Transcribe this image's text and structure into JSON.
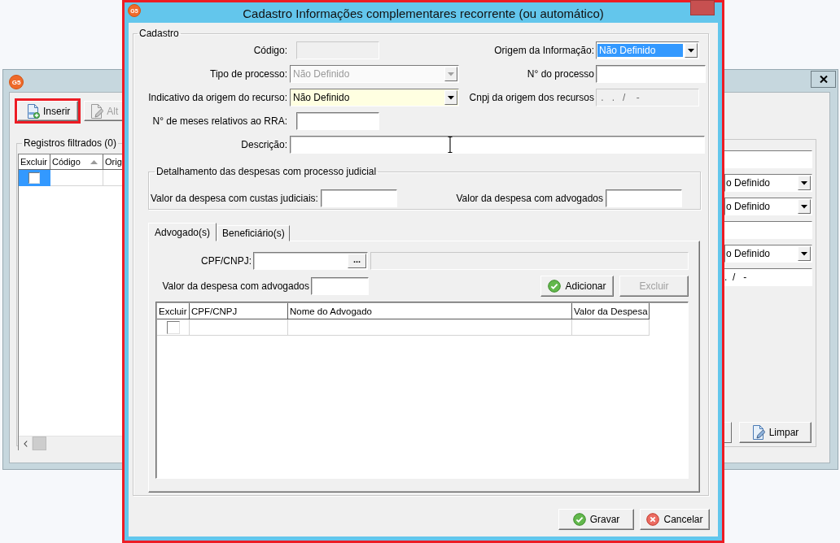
{
  "background_window": {
    "logo": "G5",
    "toolbar": [
      {
        "kind": "insert",
        "label": "Inserir",
        "disabled": false,
        "highlighted": true
      },
      {
        "kind": "edit",
        "label": "Alt",
        "disabled": true,
        "highlighted": false
      }
    ],
    "records": {
      "legend": "Registros filtrados (0)",
      "columns": [
        {
          "label": "Excluir",
          "sorted": false
        },
        {
          "label": "Código",
          "sorted": true
        },
        {
          "label": "Orig",
          "sorted": false
        }
      ],
      "rows": [
        {
          "checked": false,
          "selected": true
        }
      ]
    },
    "side_fields": [
      {
        "kind": "text"
      },
      {
        "kind": "combo",
        "value": "o Definido"
      },
      {
        "kind": "combo",
        "value": "o Definido"
      },
      {
        "kind": "text"
      },
      {
        "kind": "combo",
        "value": "o Definido"
      },
      {
        "kind": "text",
        "value": ".  /   -"
      }
    ],
    "side_button": {
      "label": "Limpar"
    }
  },
  "dialog": {
    "logo": "G5",
    "title": "Cadastro Informações complementares recorrente (ou automático)",
    "highlighted": true,
    "cadastro": {
      "legend": "Cadastro",
      "rows": [
        [
          {
            "kind": "text",
            "label": "Código:",
            "disabled": true
          },
          {
            "kind": "combo",
            "label": "Origem da Informação:",
            "value": "Não Definido",
            "disabled": false,
            "focused": true
          }
        ],
        [
          {
            "kind": "combo",
            "label": "Tipo de processo:",
            "value": "Não Definido",
            "disabled": true,
            "focused": false
          },
          {
            "kind": "text",
            "label": "N° do processo",
            "disabled": false
          }
        ],
        [
          {
            "kind": "combo",
            "label": "Indicativo da origem do recurso:",
            "value": "Não Definido",
            "disabled": false,
            "focused": false,
            "highlighted": true
          },
          {
            "kind": "text",
            "label": "Cnpj da origem dos recursos",
            "placeholder": " .   .   /    -",
            "disabled": true
          }
        ],
        [
          {
            "kind": "text",
            "label": "N° de meses relativos ao RRA:",
            "disabled": false
          }
        ]
      ],
      "description": {
        "label": "Descrição:"
      }
    },
    "detalhamento": {
      "legend": "Detalhamento das despesas com processo judicial",
      "fields": [
        {
          "label": "Valor da despesa com custas judiciais:"
        },
        {
          "label": "Valor da despesa com advogados"
        }
      ]
    },
    "tabs": [
      {
        "label": "Advogado(s)",
        "selected": true
      },
      {
        "label": "Beneficiário(s)",
        "selected": false
      }
    ],
    "advogados": {
      "cpf_label": "CPF/CNPJ:",
      "browse_label": "...",
      "valor_label": "Valor da despesa com advogados",
      "buttons": [
        {
          "kind": "add",
          "label": "Adicionar",
          "disabled": false
        },
        {
          "kind": "delete",
          "label": "Excluir",
          "disabled": true
        }
      ],
      "columns": [
        "Excluir",
        "CPF/CNPJ",
        "Nome do Advogado",
        "Valor da Despesa"
      ],
      "rows": [
        {
          "checked": false
        }
      ]
    },
    "buttons": [
      {
        "kind": "save",
        "label": "Gravar"
      },
      {
        "kind": "cancel",
        "label": "Cancelar"
      }
    ]
  }
}
